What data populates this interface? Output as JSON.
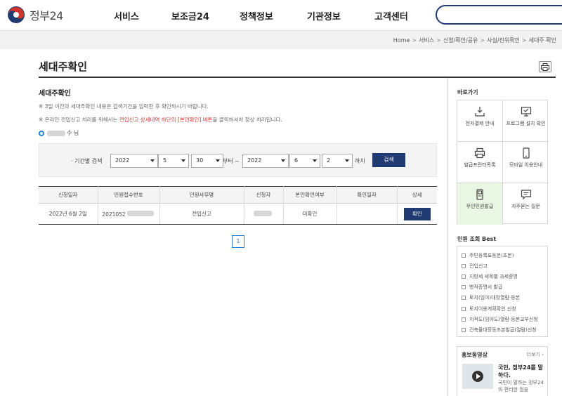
{
  "header": {
    "logo_text": "정부24",
    "nav": [
      "서비스",
      "보조금24",
      "정책정보",
      "기관정보",
      "고객센터"
    ],
    "search_placeholder": ""
  },
  "breadcrumb": [
    "Home",
    "서비스",
    "신청/확인/공유",
    "사실/진위확인",
    "세대주 확인"
  ],
  "page": {
    "title": "세대주확인",
    "print_icon": "printer-icon"
  },
  "main": {
    "section_title": "세대주확인",
    "notice1": "※ 3일 이전의 세대주확인 내용은 검색기간을 입력한 후 확인하시기 바랍니다.",
    "notice2_prefix": "※ 온라인 전입신고 처리를 위해서는 ",
    "notice2_red": "전입신고 상세내역 하단의 [본인확인] 버튼",
    "notice2_suffix": "을 클릭하셔야 정상 처리됩니다.",
    "user_suffix": "수 님"
  },
  "search": {
    "label": "· 기간별 검색",
    "from_year": "2022",
    "from_month": "5",
    "from_day": "30",
    "from_text": "부터 ~",
    "to_year": "2022",
    "to_month": "6",
    "to_day": "2",
    "to_text": "까지",
    "button": "검색"
  },
  "table": {
    "headers": [
      "신청일자",
      "민원접수번호",
      "민원사무명",
      "신청자",
      "본인확인여부",
      "확인일자",
      "상세"
    ],
    "rows": [
      {
        "date": "2022년 6월 2일",
        "receipt_no": "2021052",
        "service": "전입신고",
        "applicant": "",
        "verified": "미확인",
        "confirm_date": "",
        "detail_button": "확인"
      }
    ]
  },
  "pagination": {
    "current": "1"
  },
  "sidebar": {
    "quick_title": "바로가기",
    "quick_links": [
      {
        "label": "전자결제 안내",
        "icon": "payment-icon"
      },
      {
        "label": "프로그램 설치 확인",
        "icon": "monitor-icon"
      },
      {
        "label": "발급프린터목록",
        "icon": "printer-icon"
      },
      {
        "label": "모바일 이용안내",
        "icon": "mobile-icon"
      },
      {
        "label": "무인민원발급",
        "icon": "kiosk-icon"
      },
      {
        "label": "자주묻는 질문",
        "icon": "chat-icon"
      }
    ],
    "best_title": "민원 조회 Best",
    "best_items": [
      "주민등록표등본(초본)",
      "전입신고",
      "지방세 세목별 과세증명",
      "병적증명서 발급",
      "토지(임야)대장열람·등본",
      "토지이용계획확인 신청",
      "지적도(임야도)열람·등본교부신청",
      "건축물대장등초본발급(열람)신청"
    ],
    "promo_title": "홍보동영상",
    "promo_more": "더보기 ›",
    "promo_head": "국민, 정부24를 말하다.",
    "promo_desc": "국민이 말하는 정부24의 편리한 점을"
  }
}
